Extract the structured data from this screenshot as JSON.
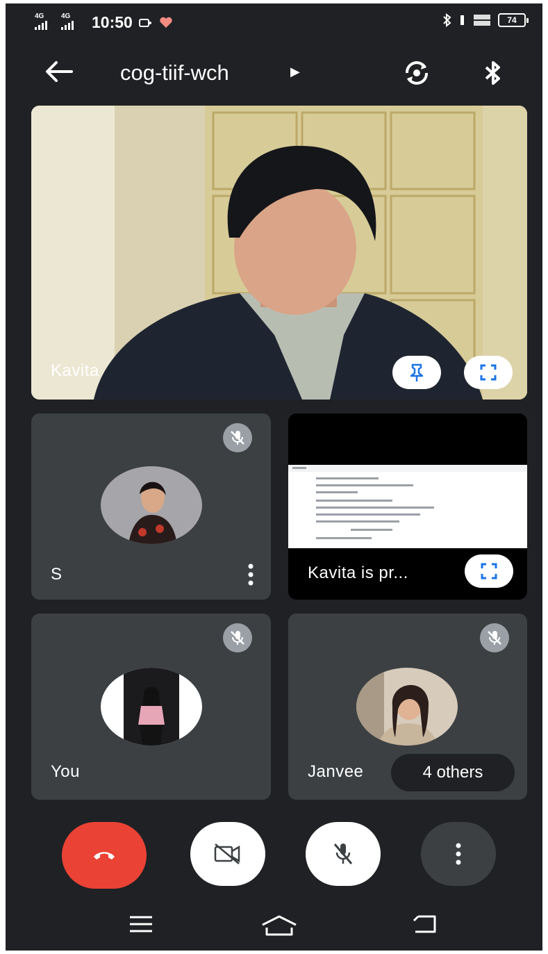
{
  "status_bar": {
    "network_1": "4G",
    "network_2": "4G",
    "time": "10:50",
    "battery": "74"
  },
  "header": {
    "meeting_code": "cog-tiif-wch"
  },
  "main_tile": {
    "participant_name": "Kavita"
  },
  "tiles": [
    {
      "participant_name": "S",
      "muted": true
    },
    {
      "participant_name": "Kavita is pr..."
    },
    {
      "participant_name": "You",
      "muted": true
    },
    {
      "participant_name": "Janvee",
      "muted": true,
      "others_label": "4 others"
    }
  ],
  "colors": {
    "background": "#202124",
    "tile": "#3c4043",
    "end_call": "#ea4335",
    "accent_blue": "#1a73e8"
  }
}
